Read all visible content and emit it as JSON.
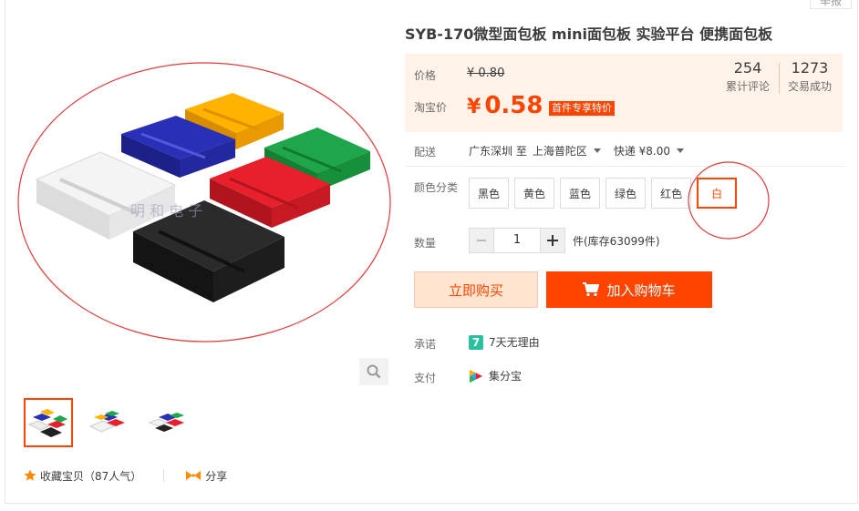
{
  "report_label": "举报",
  "product": {
    "title": "SYB-170微型面包板 mini面包板 实验平台 便携面包板"
  },
  "price": {
    "label": "价格",
    "original": "¥ 0.80",
    "taobao_label": "淘宝价",
    "currency": "¥",
    "value": "0.58",
    "promo_tag": "首件专享特价"
  },
  "stats": [
    {
      "number": "254",
      "label": "累计评论"
    },
    {
      "number": "1273",
      "label": "交易成功"
    }
  ],
  "delivery": {
    "label": "配送",
    "from": "广东深圳 至",
    "to": "上海普陀区",
    "method": "快递 ¥8.00"
  },
  "colors": {
    "label": "颜色分类",
    "options": [
      "黑色",
      "黄色",
      "蓝色",
      "绿色",
      "红色",
      "白"
    ],
    "selected": "白"
  },
  "quantity": {
    "label": "数量",
    "value": "1",
    "stock": "件(库存63099件)"
  },
  "buttons": {
    "buy_now": "立即购买",
    "add_cart": "加入购物车"
  },
  "promise": {
    "label": "承诺",
    "icon_text": "7",
    "text": "7天无理由"
  },
  "payment": {
    "label": "支付",
    "text": "集分宝"
  },
  "gallery": {
    "watermark": "明 和 电 子"
  },
  "actions": {
    "favorite": "收藏宝贝（87人气）",
    "share": "分享"
  },
  "colors_theme": {
    "accent": "#ff4400",
    "price_bg": "#fff2e8",
    "promise_icon": "#2bc1a0"
  }
}
